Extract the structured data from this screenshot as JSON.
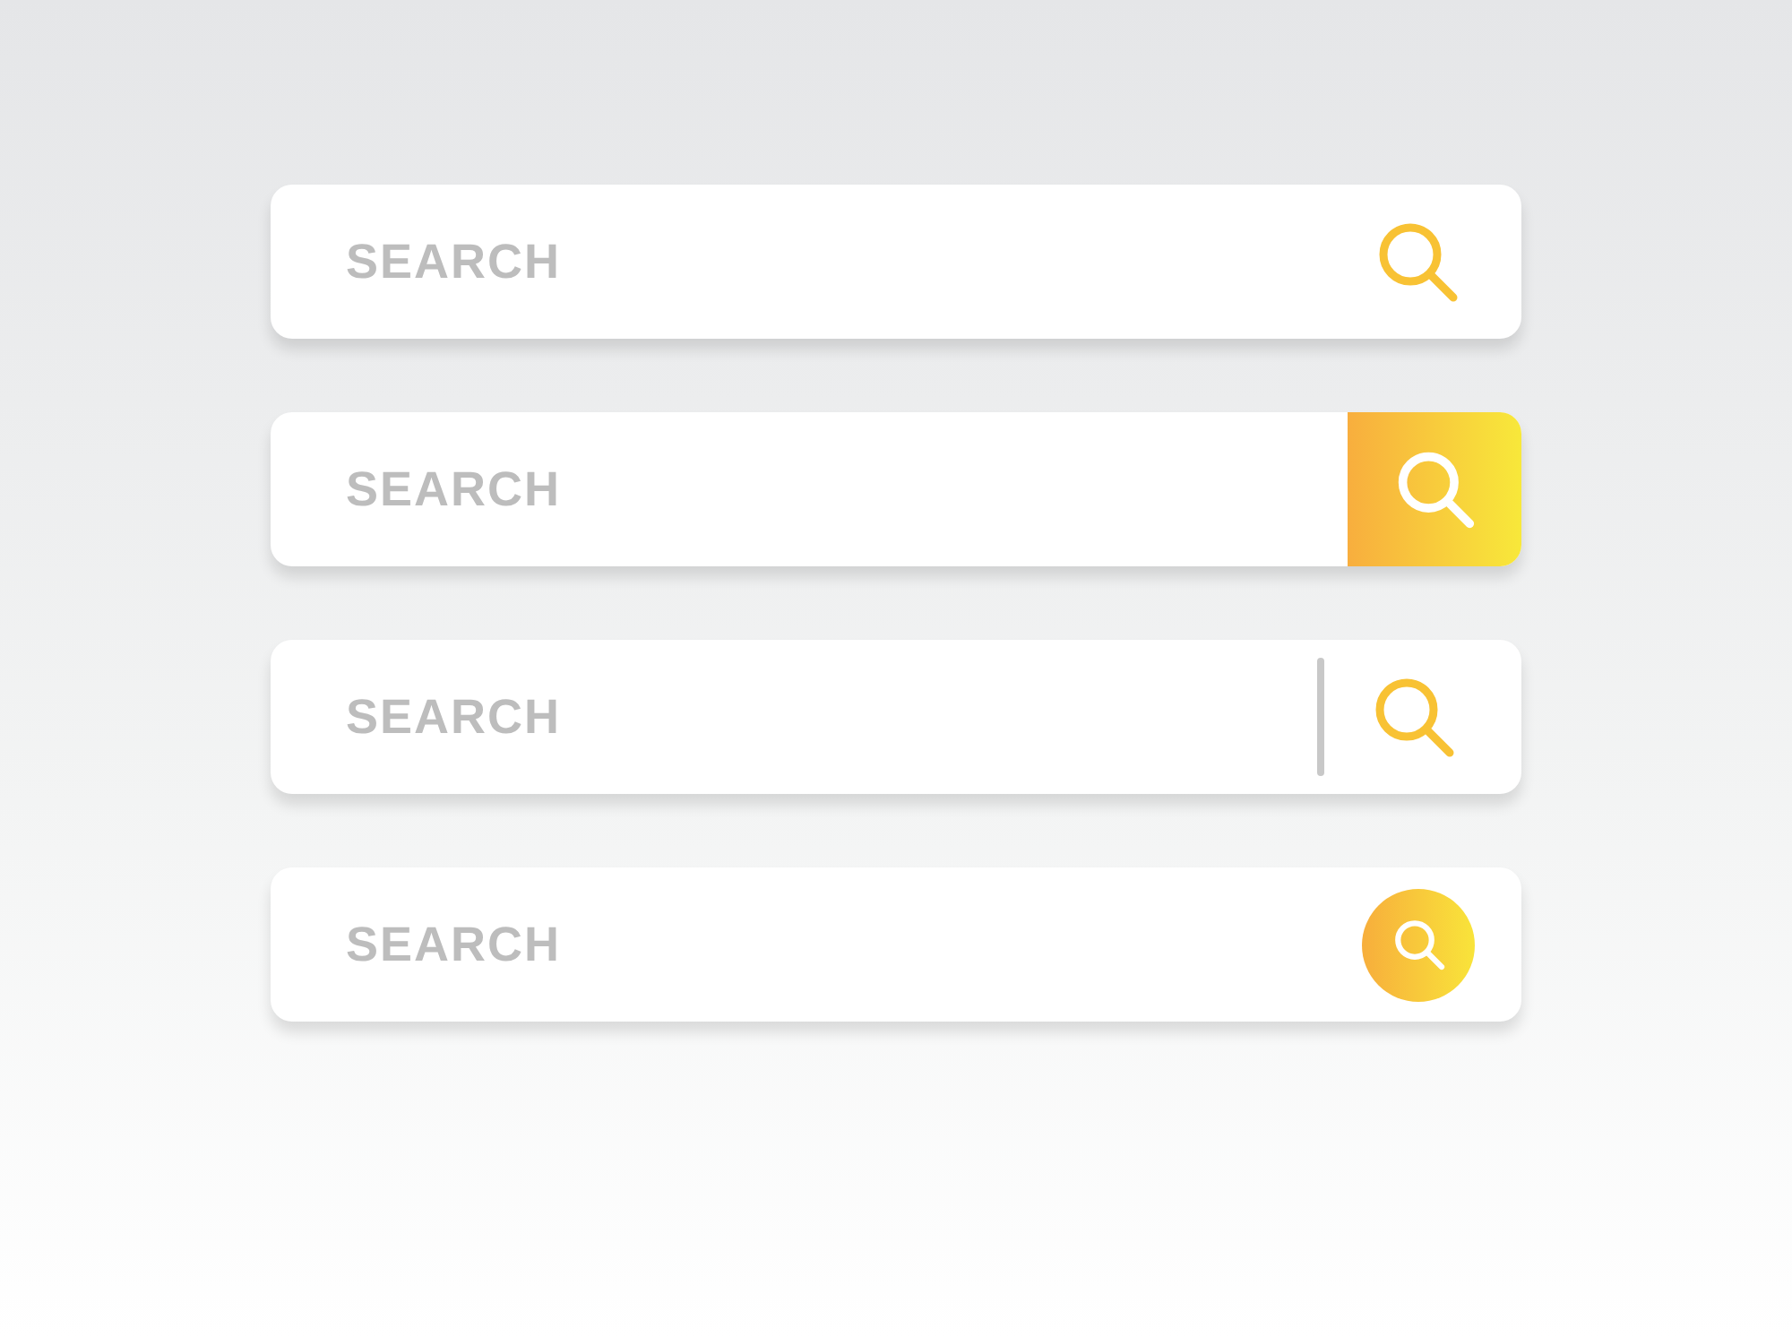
{
  "search_bars": [
    {
      "kind": "plain",
      "placeholder": "SEARCH"
    },
    {
      "kind": "square-button",
      "placeholder": "SEARCH"
    },
    {
      "kind": "divider",
      "placeholder": "SEARCH"
    },
    {
      "kind": "round-button",
      "placeholder": "SEARCH"
    }
  ]
}
